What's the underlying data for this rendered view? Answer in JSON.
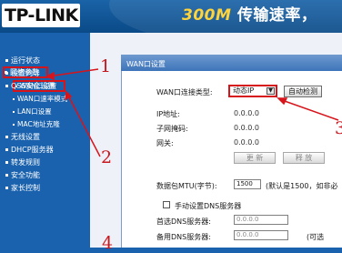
{
  "header": {
    "logo": "TP-LINK",
    "slogan_num": "300M",
    "slogan_text": "传输速率，"
  },
  "sidebar": {
    "items": [
      {
        "label": "运行状态"
      },
      {
        "label": "设置向导"
      },
      {
        "label": "QSS安全设置"
      },
      {
        "label": "网络参数"
      },
      {
        "label": "WAN口设置"
      },
      {
        "label": "WAN口速率模式"
      },
      {
        "label": "LAN口设置"
      },
      {
        "label": "MAC地址克隆"
      },
      {
        "label": "无线设置"
      },
      {
        "label": "DHCP服务器"
      },
      {
        "label": "转发规则"
      },
      {
        "label": "安全功能"
      },
      {
        "label": "家长控制"
      }
    ]
  },
  "panel": {
    "title": "WAN口设置",
    "conn_type_label": "WAN口连接类型:",
    "conn_type_value": "动态IP",
    "auto_detect_button": "自动检测",
    "ip_label": "IP地址:",
    "ip_value": "0.0.0.0",
    "mask_label": "子网掩码:",
    "mask_value": "0.0.0.0",
    "gateway_label": "网关:",
    "gateway_value": "0.0.0.0",
    "renew_button": "更 新",
    "release_button": "释 放",
    "mtu_label": "数据包MTU(字节):",
    "mtu_value": "1500",
    "mtu_hint": "(默认是1500，如非必",
    "manual_dns_label": "手动设置DNS服务器",
    "primary_dns_label": "首选DNS服务器:",
    "primary_dns_value": "0.0.0.0",
    "secondary_dns_label": "备用DNS服务器:",
    "secondary_dns_value": "0.0.0.0",
    "secondary_dns_hint": "(可选"
  },
  "annotations": {
    "n1": "1",
    "n2": "2",
    "n3": "3",
    "n4": "4"
  },
  "colors": {
    "sidebar_bg": "#1a62ad",
    "header_bg": "#0a4a88",
    "annotation_red": "#d8141b",
    "panel_title_bg": "#3d74b9"
  }
}
